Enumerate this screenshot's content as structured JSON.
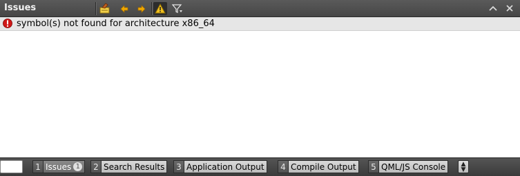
{
  "panel": {
    "title": "Issues",
    "toolbar": [
      {
        "name": "clean-issues-icon"
      },
      {
        "name": "previous-item-icon"
      },
      {
        "name": "next-item-icon"
      },
      {
        "name": "warnings-filter-icon"
      },
      {
        "name": "filter-icon"
      }
    ],
    "right_buttons": [
      "maximize-panel-icon",
      "close-panel-icon"
    ]
  },
  "issues": [
    {
      "severity": "error",
      "text": "symbol(s) not found for architecture x86_64"
    }
  ],
  "bottom_tabs": [
    {
      "num": "1",
      "label": "Issues",
      "badge": "1",
      "active": true
    },
    {
      "num": "2",
      "label": "Search Results"
    },
    {
      "num": "3",
      "label": "Application Output"
    },
    {
      "num": "4",
      "label": "Compile Output"
    },
    {
      "num": "5",
      "label": "QML/JS Console"
    }
  ],
  "colors": {
    "error": "#d01818",
    "warning": "#f0c020",
    "arrow": "#f0a800"
  }
}
